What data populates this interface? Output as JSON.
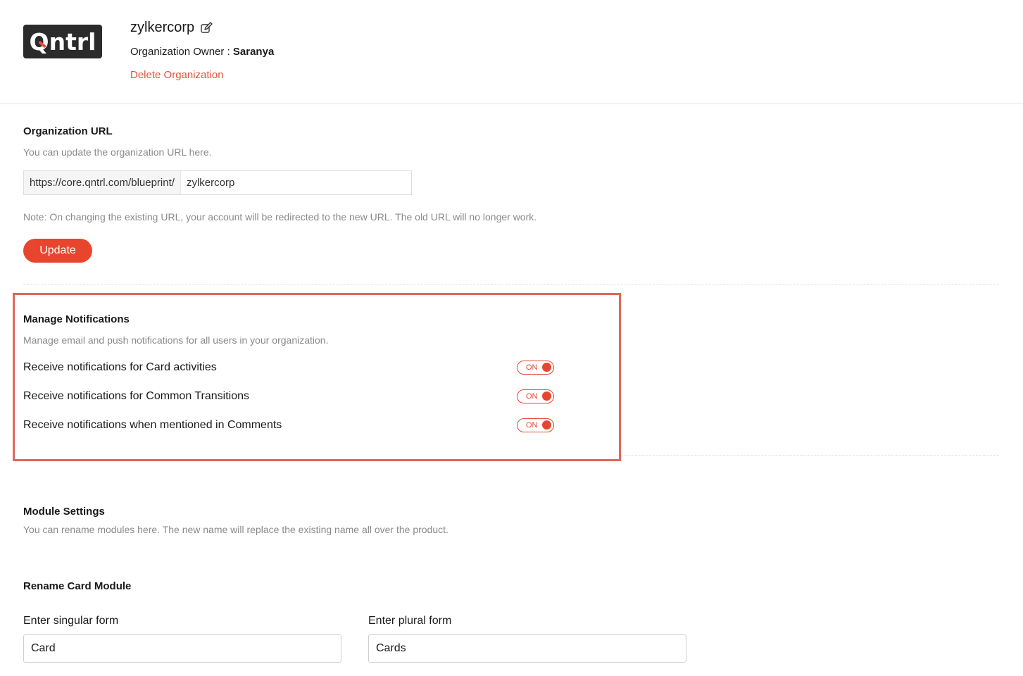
{
  "header": {
    "logo_text": "Qntrl",
    "org_name": "zylkercorp",
    "owner_label": "Organization Owner : ",
    "owner_name": "Saranya",
    "delete_label": "Delete Organization"
  },
  "org_url": {
    "title": "Organization URL",
    "description": "You can update the organization URL here.",
    "prefix": "https://core.qntrl.com/blueprint/",
    "value": "zylkercorp",
    "note": "Note: On changing the existing URL, your account will be redirected to the new URL. The old URL will no longer work.",
    "update_label": "Update"
  },
  "notifications": {
    "title": "Manage Notifications",
    "description": "Manage email and push notifications for all users in your organization.",
    "items": [
      {
        "label": "Receive notifications for Card activities",
        "state": "ON"
      },
      {
        "label": "Receive notifications for Common Transitions",
        "state": "ON"
      },
      {
        "label": "Receive notifications when mentioned in Comments",
        "state": "ON"
      }
    ],
    "highlight_color": "#e2665a"
  },
  "modules": {
    "title": "Module Settings",
    "description": "You can rename modules here. The new name will replace the existing name all over the product.",
    "rename_title": "Rename Card Module",
    "singular_label": "Enter singular form",
    "singular_value": "Card",
    "plural_label": "Enter plural form",
    "plural_value": "Cards"
  },
  "colors": {
    "accent": "#e8452e",
    "link": "#e0533f",
    "logo_bg": "#2b2b2b"
  }
}
